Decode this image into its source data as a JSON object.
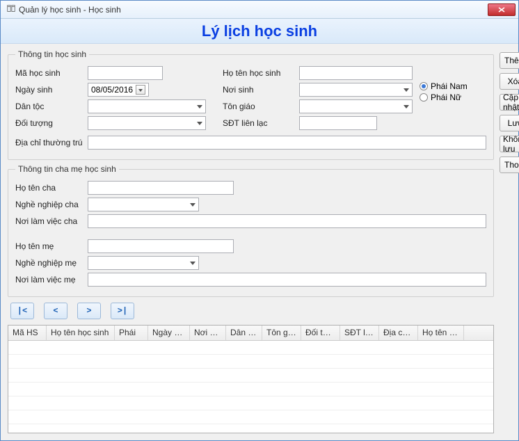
{
  "window": {
    "title": "Quản lý học sinh - Học sinh"
  },
  "header": {
    "title": "Lý lịch học sinh"
  },
  "groups": {
    "student": "Thông tin học sinh",
    "parent": "Thông tin cha mẹ học sinh"
  },
  "labels": {
    "maHS": "Mã học sinh",
    "ngaySinh": "Ngày sinh",
    "danToc": "Dân tộc",
    "doiTuong": "Đối tượng",
    "diaChi": "Địa chỉ thường trú",
    "hoTenHS": "Họ tên học sinh",
    "noiSinh": "Nơi sinh",
    "tonGiao": "Tôn giáo",
    "sdt": "SĐT liên lạc",
    "hoTenCha": "Họ tên cha",
    "ngheCha": "Nghề nghiệp cha",
    "noiLamCha": "Nơi làm việc cha",
    "hoTenMe": "Họ tên mẹ",
    "ngheMe": "Nghề nghiệp mẹ",
    "noiLamMe": "Nơi làm việc mẹ"
  },
  "values": {
    "maHS": "",
    "ngaySinh": "08/05/2016",
    "danToc": "",
    "doiTuong": "",
    "diaChi": "",
    "hoTenHS": "",
    "noiSinh": "",
    "tonGiao": "",
    "sdt": "",
    "hoTenCha": "",
    "ngheCha": "",
    "noiLamCha": "",
    "hoTenMe": "",
    "ngheMe": "",
    "noiLamMe": ""
  },
  "gender": {
    "male": "Phái Nam",
    "female": "Phái Nữ",
    "selected": "male"
  },
  "buttons": {
    "them": "Thêm",
    "xoa": "Xóa",
    "capNhat": "Cập nhật",
    "luu": "Lưu",
    "khongLuu": "Không lưu",
    "thoat": "Thoát"
  },
  "nav": {
    "first": "|<",
    "prev": "<",
    "next": ">",
    "last": ">|"
  },
  "grid": {
    "columns": [
      "Mã HS",
      "Họ tên học sinh",
      "Phái",
      "Ngày sinh",
      "Nơi sinh",
      "Dân tộc",
      "Tôn giáo",
      "Đối tượ...",
      "SĐT liê...",
      "Địa chỉ t...",
      "Họ tên cha"
    ],
    "widths": [
      55,
      98,
      48,
      60,
      52,
      52,
      56,
      56,
      56,
      56,
      66
    ]
  }
}
